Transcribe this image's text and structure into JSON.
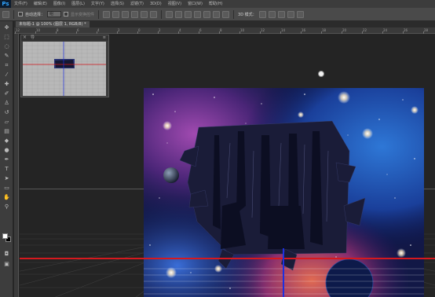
{
  "app": {
    "logo": "Ps",
    "menu": [
      "文件(F)",
      "编辑(E)",
      "图像(I)",
      "图层(L)",
      "文字(Y)",
      "选择(S)",
      "滤镜(T)",
      "3D(D)",
      "视图(V)",
      "窗口(W)",
      "帮助(H)"
    ]
  },
  "options": {
    "auto_select_label": "自动选择：",
    "auto_select_value": "组",
    "show_transform_label": "显示变换控件",
    "mode_3d_label": "3D 模式："
  },
  "document": {
    "tab_title": "未标题-1 @ 100% (图层 1, RGB/8) *"
  },
  "ruler": {
    "ticks": [
      "12",
      "10",
      "8",
      "6",
      "4",
      "2",
      "0",
      "2",
      "4",
      "6",
      "8",
      "10",
      "12",
      "14",
      "16",
      "18",
      "20",
      "22",
      "24",
      "26",
      "28"
    ]
  },
  "tools": [
    {
      "name": "move-tool-icon",
      "glyph": "✥"
    },
    {
      "name": "marquee-tool-icon",
      "glyph": "⬚"
    },
    {
      "name": "lasso-tool-icon",
      "glyph": "◌"
    },
    {
      "name": "quick-select-tool-icon",
      "glyph": "✎"
    },
    {
      "name": "crop-tool-icon",
      "glyph": "⌗"
    },
    {
      "name": "eyedropper-tool-icon",
      "glyph": "⁄"
    },
    {
      "name": "healing-brush-tool-icon",
      "glyph": "✚"
    },
    {
      "name": "brush-tool-icon",
      "glyph": "✐"
    },
    {
      "name": "clone-stamp-tool-icon",
      "glyph": "♙"
    },
    {
      "name": "history-brush-tool-icon",
      "glyph": "↺"
    },
    {
      "name": "eraser-tool-icon",
      "glyph": "▱"
    },
    {
      "name": "gradient-tool-icon",
      "glyph": "▤"
    },
    {
      "name": "blur-tool-icon",
      "glyph": "◆"
    },
    {
      "name": "dodge-tool-icon",
      "glyph": "●"
    },
    {
      "name": "pen-tool-icon",
      "glyph": "✒"
    },
    {
      "name": "type-tool-icon",
      "glyph": "T"
    },
    {
      "name": "path-select-tool-icon",
      "glyph": "➤"
    },
    {
      "name": "shape-tool-icon",
      "glyph": "▭"
    },
    {
      "name": "hand-tool-icon",
      "glyph": "✋"
    },
    {
      "name": "zoom-tool-icon",
      "glyph": "⚲"
    }
  ],
  "colors": {
    "guide_red": "#d6191e",
    "guide_blue": "#1e2fe0",
    "foreground": "#ffffff",
    "background": "#000000"
  },
  "navigator": {
    "close": "×",
    "title": "导"
  }
}
